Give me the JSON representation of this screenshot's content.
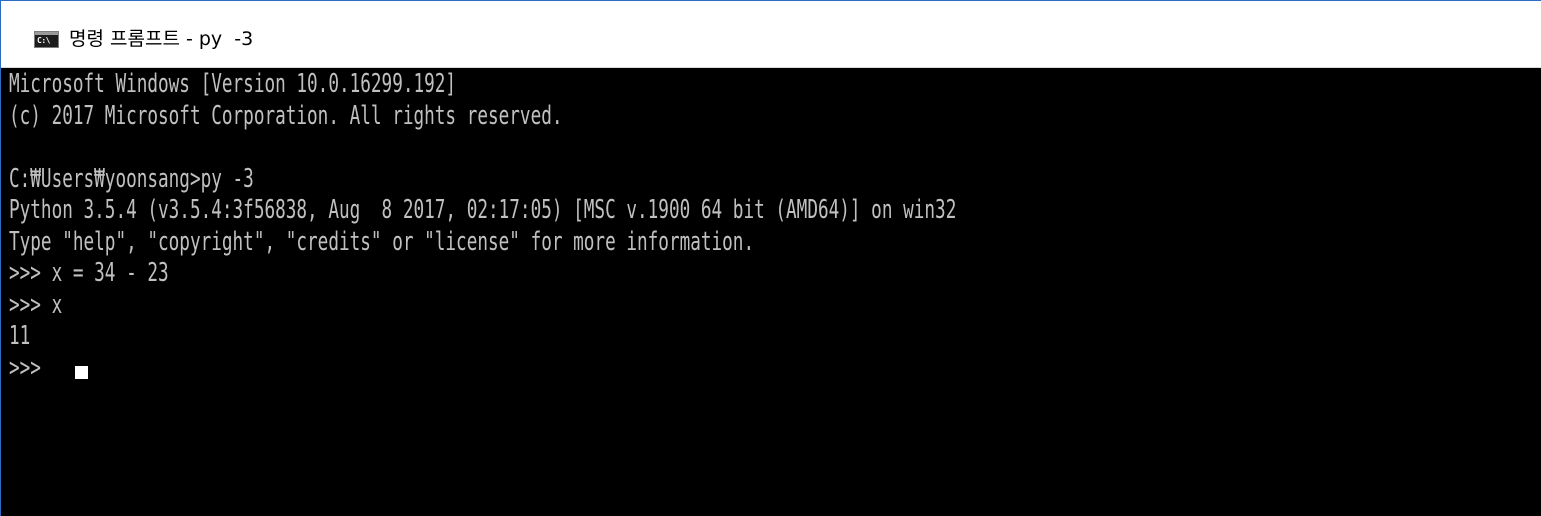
{
  "window": {
    "title": "명령 프롬프트 - py  -3",
    "icon": "cmd-icon",
    "icon_glyph": "C:\\"
  },
  "console": {
    "lines": [
      "Microsoft Windows [Version 10.0.16299.192]",
      "(c) 2017 Microsoft Corporation. All rights reserved.",
      "",
      "C:\\Users\\yoonsang>py -3",
      "Python 3.5.4 (v3.5.4:3f56838, Aug  8 2017, 02:17:05) [MSC v.1900 64 bit (AMD64)] on win32",
      "Type \"help\", \"copyright\", \"credits\" or \"license\" for more information.",
      ">>> x = 34 - 23",
      ">>> x",
      "11"
    ],
    "current_prompt": ">>> ",
    "text_color": "#c0c0c0",
    "background_color": "#000000"
  }
}
